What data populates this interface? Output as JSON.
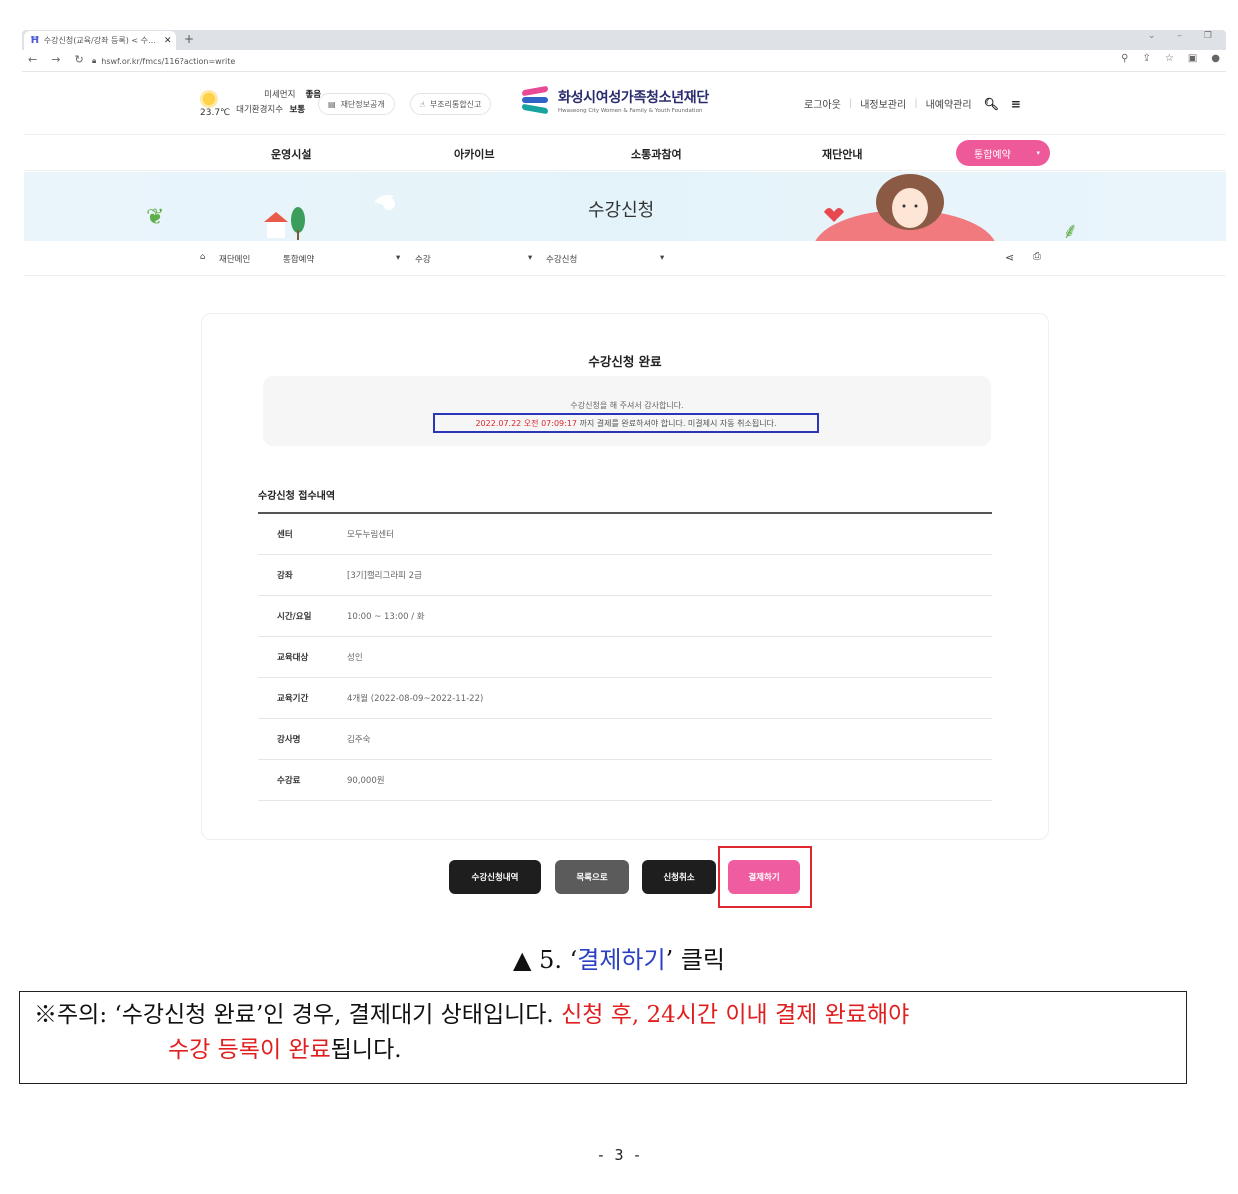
{
  "browser": {
    "tab_title": "수강신청(교육/강좌 등록) < 수…",
    "url": "hswf.or.kr/fmcs/116?action=write"
  },
  "header": {
    "weather_temp": "23.7℃",
    "fine_dust_label": "미세먼지",
    "fine_dust_value": "좋음",
    "air_index_label": "대기환경지수",
    "air_index_value": "보통",
    "info_disclosure": "재단정보공개",
    "anti_corruption": "부조리통합신고",
    "org_name": "화성시여성가족청소년재단",
    "org_name_en": "Hwaseong City Women & Family & Youth Foundation",
    "logout": "로그아웃",
    "my_info": "내정보관리",
    "my_reservations": "내예약관리"
  },
  "gnb": {
    "items": [
      "운영시설",
      "아카이브",
      "소통과참여",
      "재단안내"
    ],
    "reservation": "통합예약"
  },
  "banner": {
    "title": "수강신청"
  },
  "breadcrumb": {
    "home": "재단메인",
    "level1": "통합예약",
    "level2": "수강",
    "level3": "수강신청"
  },
  "content": {
    "title": "수강신청 완료",
    "thanks": "수강신청을 해 주셔서 감사합니다.",
    "deadline_datetime": "2022.07.22 오전 07:09:17",
    "deadline_rest": " 까지 결제를 완료하셔야 합니다. 미결제시 자동 취소됩니다.",
    "section_title": "수강신청 접수내역",
    "rows": [
      {
        "label": "센터",
        "value": "모두누림센터"
      },
      {
        "label": "강좌",
        "value": "[3기]캘리그라피 2급"
      },
      {
        "label": "시간/요일",
        "value": "10:00 ~ 13:00 / 화"
      },
      {
        "label": "교육대상",
        "value": "성인"
      },
      {
        "label": "교육기간",
        "value": "4개월 (2022-08-09~2022-11-22)"
      },
      {
        "label": "강사명",
        "value": "김주숙"
      },
      {
        "label": "수강료",
        "value": "90,000원"
      }
    ]
  },
  "buttons": {
    "history": "수강신청내역",
    "list": "목록으로",
    "cancel": "신청취소",
    "pay": "결제하기"
  },
  "caption": {
    "prefix": "▲ 5. ‘",
    "highlight": "결제하기",
    "suffix": "’ 클릭"
  },
  "note": {
    "line1_black": "※주의: ‘수강신청 완료’인 경우, 결제대기 상태입니다. ",
    "line1_red": "신청 후, 24시간 이내 결제 완료해야",
    "line2_red": "수강 등록이 완료",
    "line2_black": "됩니다."
  },
  "page_number": "- 3 -",
  "colors": {
    "accent_pink": "#ef5c9f",
    "highlight_red": "#e0262e",
    "deadline_box_blue": "#2a35b8"
  }
}
